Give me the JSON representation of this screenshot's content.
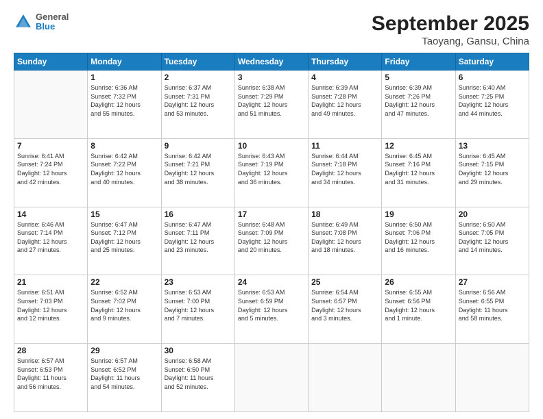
{
  "header": {
    "logo": {
      "line1": "General",
      "line2": "Blue"
    },
    "title": "September 2025",
    "subtitle": "Taoyang, Gansu, China"
  },
  "columns": [
    "Sunday",
    "Monday",
    "Tuesday",
    "Wednesday",
    "Thursday",
    "Friday",
    "Saturday"
  ],
  "weeks": [
    [
      {
        "day": "",
        "info": ""
      },
      {
        "day": "1",
        "info": "Sunrise: 6:36 AM\nSunset: 7:32 PM\nDaylight: 12 hours\nand 55 minutes."
      },
      {
        "day": "2",
        "info": "Sunrise: 6:37 AM\nSunset: 7:31 PM\nDaylight: 12 hours\nand 53 minutes."
      },
      {
        "day": "3",
        "info": "Sunrise: 6:38 AM\nSunset: 7:29 PM\nDaylight: 12 hours\nand 51 minutes."
      },
      {
        "day": "4",
        "info": "Sunrise: 6:39 AM\nSunset: 7:28 PM\nDaylight: 12 hours\nand 49 minutes."
      },
      {
        "day": "5",
        "info": "Sunrise: 6:39 AM\nSunset: 7:26 PM\nDaylight: 12 hours\nand 47 minutes."
      },
      {
        "day": "6",
        "info": "Sunrise: 6:40 AM\nSunset: 7:25 PM\nDaylight: 12 hours\nand 44 minutes."
      }
    ],
    [
      {
        "day": "7",
        "info": "Sunrise: 6:41 AM\nSunset: 7:24 PM\nDaylight: 12 hours\nand 42 minutes."
      },
      {
        "day": "8",
        "info": "Sunrise: 6:42 AM\nSunset: 7:22 PM\nDaylight: 12 hours\nand 40 minutes."
      },
      {
        "day": "9",
        "info": "Sunrise: 6:42 AM\nSunset: 7:21 PM\nDaylight: 12 hours\nand 38 minutes."
      },
      {
        "day": "10",
        "info": "Sunrise: 6:43 AM\nSunset: 7:19 PM\nDaylight: 12 hours\nand 36 minutes."
      },
      {
        "day": "11",
        "info": "Sunrise: 6:44 AM\nSunset: 7:18 PM\nDaylight: 12 hours\nand 34 minutes."
      },
      {
        "day": "12",
        "info": "Sunrise: 6:45 AM\nSunset: 7:16 PM\nDaylight: 12 hours\nand 31 minutes."
      },
      {
        "day": "13",
        "info": "Sunrise: 6:45 AM\nSunset: 7:15 PM\nDaylight: 12 hours\nand 29 minutes."
      }
    ],
    [
      {
        "day": "14",
        "info": "Sunrise: 6:46 AM\nSunset: 7:14 PM\nDaylight: 12 hours\nand 27 minutes."
      },
      {
        "day": "15",
        "info": "Sunrise: 6:47 AM\nSunset: 7:12 PM\nDaylight: 12 hours\nand 25 minutes."
      },
      {
        "day": "16",
        "info": "Sunrise: 6:47 AM\nSunset: 7:11 PM\nDaylight: 12 hours\nand 23 minutes."
      },
      {
        "day": "17",
        "info": "Sunrise: 6:48 AM\nSunset: 7:09 PM\nDaylight: 12 hours\nand 20 minutes."
      },
      {
        "day": "18",
        "info": "Sunrise: 6:49 AM\nSunset: 7:08 PM\nDaylight: 12 hours\nand 18 minutes."
      },
      {
        "day": "19",
        "info": "Sunrise: 6:50 AM\nSunset: 7:06 PM\nDaylight: 12 hours\nand 16 minutes."
      },
      {
        "day": "20",
        "info": "Sunrise: 6:50 AM\nSunset: 7:05 PM\nDaylight: 12 hours\nand 14 minutes."
      }
    ],
    [
      {
        "day": "21",
        "info": "Sunrise: 6:51 AM\nSunset: 7:03 PM\nDaylight: 12 hours\nand 12 minutes."
      },
      {
        "day": "22",
        "info": "Sunrise: 6:52 AM\nSunset: 7:02 PM\nDaylight: 12 hours\nand 9 minutes."
      },
      {
        "day": "23",
        "info": "Sunrise: 6:53 AM\nSunset: 7:00 PM\nDaylight: 12 hours\nand 7 minutes."
      },
      {
        "day": "24",
        "info": "Sunrise: 6:53 AM\nSunset: 6:59 PM\nDaylight: 12 hours\nand 5 minutes."
      },
      {
        "day": "25",
        "info": "Sunrise: 6:54 AM\nSunset: 6:57 PM\nDaylight: 12 hours\nand 3 minutes."
      },
      {
        "day": "26",
        "info": "Sunrise: 6:55 AM\nSunset: 6:56 PM\nDaylight: 12 hours\nand 1 minute."
      },
      {
        "day": "27",
        "info": "Sunrise: 6:56 AM\nSunset: 6:55 PM\nDaylight: 11 hours\nand 58 minutes."
      }
    ],
    [
      {
        "day": "28",
        "info": "Sunrise: 6:57 AM\nSunset: 6:53 PM\nDaylight: 11 hours\nand 56 minutes."
      },
      {
        "day": "29",
        "info": "Sunrise: 6:57 AM\nSunset: 6:52 PM\nDaylight: 11 hours\nand 54 minutes."
      },
      {
        "day": "30",
        "info": "Sunrise: 6:58 AM\nSunset: 6:50 PM\nDaylight: 11 hours\nand 52 minutes."
      },
      {
        "day": "",
        "info": ""
      },
      {
        "day": "",
        "info": ""
      },
      {
        "day": "",
        "info": ""
      },
      {
        "day": "",
        "info": ""
      }
    ]
  ]
}
